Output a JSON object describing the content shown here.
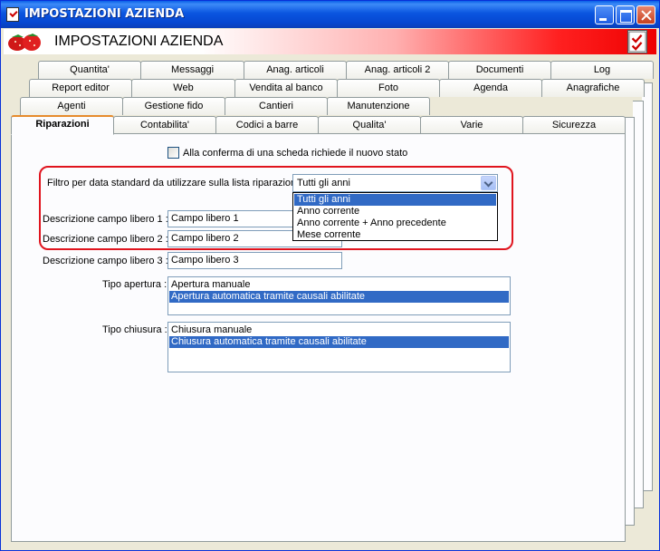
{
  "window": {
    "title": "IMPOSTAZIONI AZIENDA"
  },
  "banner": {
    "title": "IMPOSTAZIONI AZIENDA"
  },
  "tabs": {
    "row1": [
      "Quantita'",
      "Messaggi",
      "Anag. articoli",
      "Anag. articoli 2",
      "Documenti",
      "Log"
    ],
    "row2": [
      "Report editor",
      "Web",
      "Vendita al banco",
      "Foto",
      "Agenda",
      "Anagrafiche"
    ],
    "row3": [
      "Agenti",
      "Gestione fido",
      "Cantieri",
      "Manutenzione"
    ],
    "row4": [
      "Riparazioni",
      "Contabilita'",
      "Codici a barre",
      "Qualita'",
      "Varie",
      "Sicurezza"
    ]
  },
  "form": {
    "checkbox_label": "Alla conferma di una scheda richiede il nuovo stato",
    "filter_label": "Filtro per data standard da utilizzare sulla lista riparazioni :",
    "filter_value": "Tutti gli anni",
    "filter_options": [
      "Tutti gli anni",
      "Anno corrente",
      "Anno corrente + Anno precedente",
      "Mese corrente"
    ],
    "campo1_label": "Descrizione campo libero 1 :",
    "campo1_value": "Campo libero 1",
    "campo2_label": "Descrizione campo libero 2 :",
    "campo2_value": "Campo libero 2",
    "campo3_label": "Descrizione campo libero 3 :",
    "campo3_value": "Campo libero 3",
    "apertura_label": "Tipo apertura :",
    "apertura_options": [
      "Apertura manuale",
      "Apertura automatica tramite causali abilitate"
    ],
    "chiusura_label": "Tipo chiusura :",
    "chiusura_options": [
      "Chiusura manuale",
      "Chiusura automatica tramite causali abilitate"
    ]
  },
  "colors": {
    "accent": "#316ac5",
    "highlight_border": "#e0141e",
    "titlebar": "#0a55e0"
  }
}
